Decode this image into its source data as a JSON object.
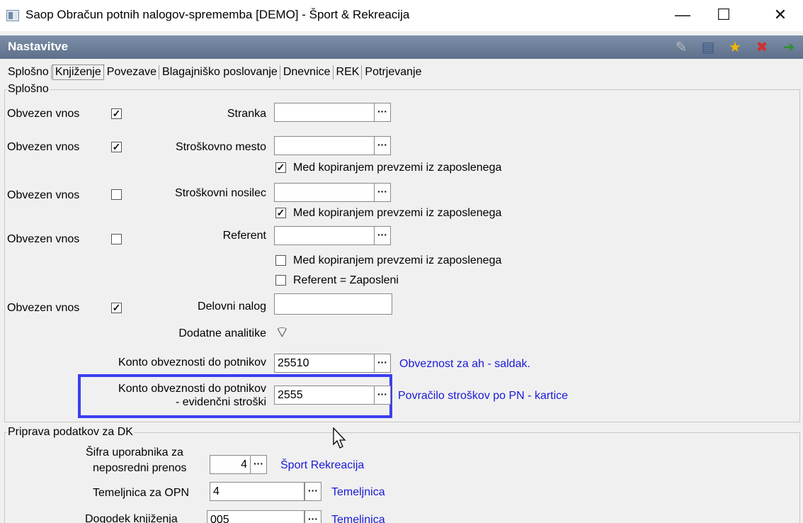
{
  "window": {
    "title": "Saop Obračun potnih nalogov-sprememba [DEMO] - Šport & Rekreacija",
    "minimize": "—",
    "maximize": "☐",
    "close": "✕"
  },
  "header": {
    "title": "Nastavitve"
  },
  "toolbar_icons": [
    "edit-icon",
    "columns-icon",
    "star-icon",
    "delete-icon",
    "exit-icon"
  ],
  "tabs": [
    "Splošno",
    "Knjiženje",
    "Povezave",
    "Blagajniško poslovanje",
    "Dnevnice",
    "REK",
    "Potrjevanje"
  ],
  "active_tab": "Knjiženje",
  "splosno": {
    "legend": "Splošno",
    "required_label": "Obvezen vnos",
    "stranka": {
      "label": "Stranka",
      "value": "",
      "required": true
    },
    "strosk_mesto": {
      "label": "Stroškovno mesto",
      "value": "",
      "required": true,
      "copy_label": "Med kopiranjem prevzemi iz zaposlenega",
      "copy": true
    },
    "strosk_nosilec": {
      "label": "Stroškovni nosilec",
      "value": "",
      "required": false,
      "copy_label": "Med kopiranjem prevzemi iz zaposlenega",
      "copy": true
    },
    "referent": {
      "label": "Referent",
      "value": "",
      "required": false,
      "copy_label": "Med kopiranjem prevzemi iz zaposlenega",
      "copy": false,
      "eq_label": "Referent = Zaposleni",
      "eq": false
    },
    "delovni_nalog": {
      "label": "Delovni nalog",
      "value": "",
      "required": true
    },
    "dodatne_analitike": {
      "label": "Dodatne analitike"
    },
    "konto1": {
      "label": "Konto obveznosti do potnikov",
      "value": "25510",
      "desc": "Obveznost za ah - saldak."
    },
    "konto2": {
      "label_line1": "Konto obveznosti do potnikov",
      "label_line2": "- evidenčni stroški",
      "value": "2555",
      "desc": "Povračilo stroškov po PN - kartice"
    }
  },
  "dk": {
    "legend": "Priprava podatkov za DK",
    "sifra": {
      "label_line1": "Šifra uporabnika za",
      "label_line2": "neposredni prenos",
      "value": "4",
      "desc": "Šport Rekreacija"
    },
    "temeljnica": {
      "label": "Temeljnica za OPN",
      "value": "4",
      "desc": "Temeljnica"
    },
    "dogodek": {
      "label": "Dogodek knjiženja",
      "value": "005",
      "desc": "Temeljnica"
    }
  },
  "dots": "···",
  "check": "✓"
}
